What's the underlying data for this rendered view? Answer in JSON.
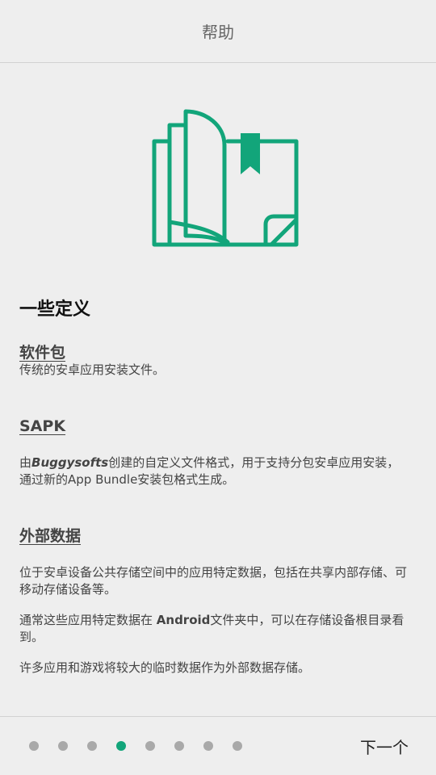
{
  "header": {
    "title": "帮助"
  },
  "hero": {
    "icon": "open-book-bookmark-icon",
    "color": "#12a57a"
  },
  "content": {
    "section_title": "一些定义",
    "terms": [
      {
        "term": "软件包",
        "desc": "传统的安卓应用安装文件。"
      },
      {
        "term": "SAPK",
        "desc_prefix": "由",
        "desc_brand": "Buggysofts",
        "desc_rest": "创建的自定义文件格式，用于支持分包安卓应用安装，",
        "desc_line2": "通过新的App Bundle安装包格式生成。"
      },
      {
        "term": "外部数据",
        "desc_p1": "位于安卓设备公共存储空间中的应用特定数据，包括在共享内部存储、可移动存储设备等。",
        "desc_p2_prefix": "通常这些应用特定数据在 ",
        "desc_p2_bold": "Android",
        "desc_p2_rest": "文件夹中，可以在存储设备根目录看到。",
        "desc_p3": "许多应用和游戏将较大的临时数据作为外部数据存储。"
      }
    ]
  },
  "footer": {
    "page_count": 8,
    "current_page": 4,
    "next_label": "下一个",
    "accent": "#12a57a",
    "dot_color": "#a9a9a9"
  }
}
